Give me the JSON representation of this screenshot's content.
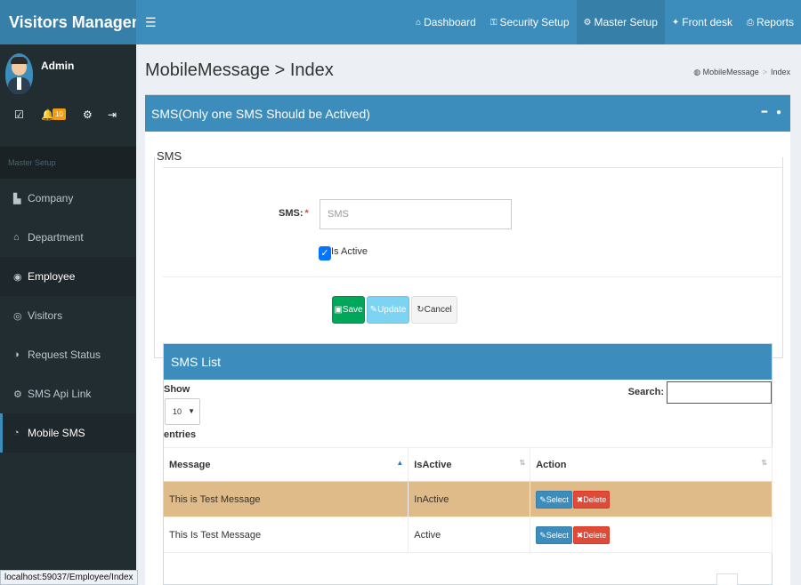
{
  "app": {
    "title": "Visitors Management"
  },
  "topnav": [
    {
      "icon": "home-icon",
      "glyph": "⌂",
      "label": "Dashboard"
    },
    {
      "icon": "unlock-icon",
      "glyph": "🔓",
      "label": "Security Setup"
    },
    {
      "icon": "cogs-icon",
      "glyph": "⚙",
      "label": "Master Setup",
      "active": true
    },
    {
      "icon": "users-icon",
      "glyph": "👥",
      "label": "Front desk"
    },
    {
      "icon": "print-icon",
      "glyph": "⎙",
      "label": "Reports"
    }
  ],
  "user": {
    "name": "Admin",
    "notification_count": "10"
  },
  "sidebar": {
    "header": "Master Setup",
    "items": [
      {
        "label": "Company",
        "icon": "building-icon"
      },
      {
        "label": "Department",
        "icon": "bank-icon"
      },
      {
        "label": "Employee",
        "icon": "user-circle-icon"
      },
      {
        "label": "Visitors",
        "icon": "eye-icon"
      },
      {
        "label": "Request Status",
        "icon": "toggle-icon"
      },
      {
        "label": "SMS Api Link",
        "icon": "cogs-icon"
      },
      {
        "label": "Mobile SMS",
        "icon": "comment-icon"
      }
    ]
  },
  "page": {
    "title": "MobileMessage > Index",
    "breadcrumb": {
      "home": "MobileMessage",
      "current": "Index"
    }
  },
  "box": {
    "title": "SMS(Only one SMS Should be Actived)"
  },
  "form": {
    "legend": "SMS",
    "sms_label": "SMS:",
    "required_mark": "*",
    "sms_placeholder": "SMS",
    "sms_value": "",
    "is_active_label": "Is Active",
    "is_active_checked": true,
    "save_label": "Save",
    "update_label": "Update",
    "cancel_label": "Cancel"
  },
  "list": {
    "title": "SMS List",
    "show_label": "Show",
    "page_length": "10",
    "entries_label": "entries",
    "search_label": "Search:",
    "columns": [
      "Message",
      "IsActive",
      "Action"
    ],
    "rows": [
      {
        "message": "This is Test Message",
        "is_active": "InActive",
        "selected": true
      },
      {
        "message": "This Is Test Message",
        "is_active": "Active",
        "selected": false
      }
    ],
    "select_label": "Select",
    "delete_label": "Delete"
  },
  "statusbar": {
    "url": "localhost:59037/Employee/Index"
  },
  "colors": {
    "primary": "#3c8dbc",
    "sidebar": "#222d32",
    "success": "#00a65a",
    "danger": "#dd4b39",
    "selected_row": "#dfbb8a"
  }
}
